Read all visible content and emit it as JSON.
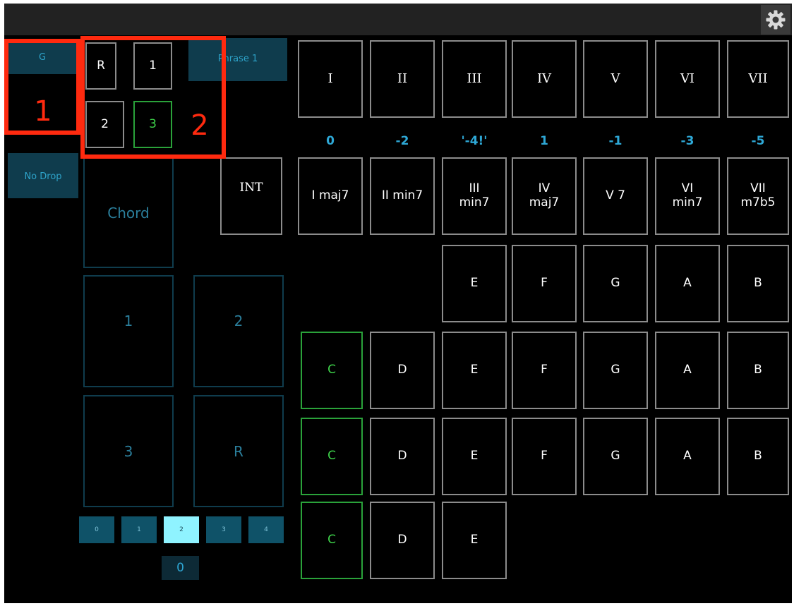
{
  "top": {
    "settings_icon": "gear-icon"
  },
  "left": {
    "key_label": "G",
    "drop_label": "No Drop",
    "phrase_label": "Phrase 1",
    "chord_label": "Chord",
    "int_label": "INT",
    "rows": [
      {
        "label": "R"
      },
      {
        "label": "1"
      },
      {
        "label": "2"
      },
      {
        "label": "3",
        "active": true
      }
    ],
    "pads": [
      "1",
      "2",
      "3",
      "R"
    ],
    "zoom": [
      "0",
      "1",
      "2",
      "3",
      "4"
    ],
    "zoom_selected": "2",
    "value": "0"
  },
  "annotations": {
    "marker1": "1",
    "marker2": "2"
  },
  "grid": {
    "degrees": [
      "I",
      "II",
      "III",
      "IV",
      "V",
      "VI",
      "VII"
    ],
    "offsets": [
      "0",
      "-2",
      "'-4!'",
      "1",
      "-1",
      "-3",
      "-5"
    ],
    "chords": [
      {
        "line1": "I maj7",
        "line2": ""
      },
      {
        "line1": "II min7",
        "line2": ""
      },
      {
        "line1": "III",
        "line2": "min7"
      },
      {
        "line1": "IV",
        "line2": "maj7"
      },
      {
        "line1": "V 7",
        "line2": ""
      },
      {
        "line1": "VI",
        "line2": "min7"
      },
      {
        "line1": "VII",
        "line2": "m7b5"
      }
    ],
    "note_row1": [
      "E",
      "F",
      "G",
      "A",
      "B"
    ],
    "note_row2": [
      "C",
      "D",
      "E",
      "F",
      "G",
      "A",
      "B"
    ],
    "note_row3": [
      "C",
      "D",
      "E",
      "F",
      "G",
      "A",
      "B"
    ],
    "note_row4": [
      "C",
      "D",
      "E"
    ]
  },
  "colors": {
    "accent_teal": "#2ea8d6",
    "active_green": "#3ed24a",
    "annotation_red": "#ff2a0f",
    "button_border": "#8c8c8c",
    "background": "#000000"
  }
}
